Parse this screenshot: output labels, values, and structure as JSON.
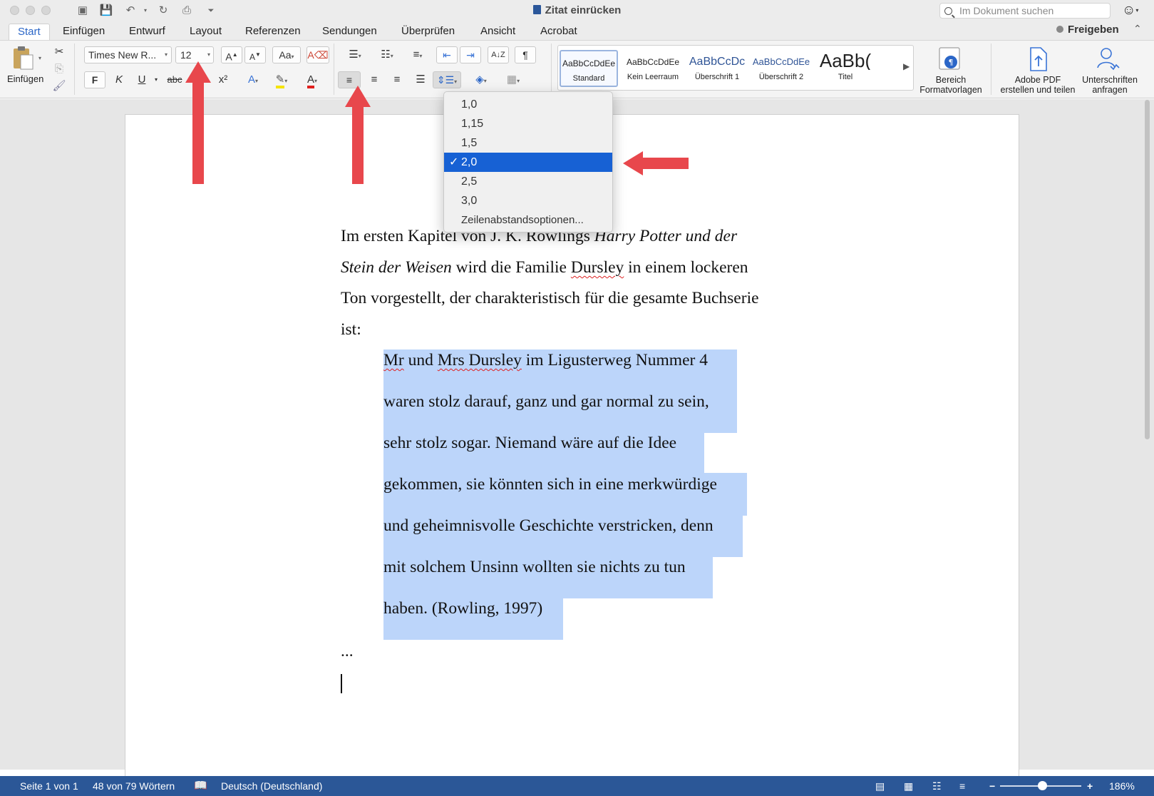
{
  "window": {
    "title": "Zitat einrücken",
    "search_placeholder": "Im Dokument suchen"
  },
  "tabs": [
    {
      "label": "Start",
      "active": true
    },
    {
      "label": "Einfügen"
    },
    {
      "label": "Entwurf"
    },
    {
      "label": "Layout"
    },
    {
      "label": "Referenzen"
    },
    {
      "label": "Sendungen"
    },
    {
      "label": "Überprüfen"
    },
    {
      "label": "Ansicht"
    },
    {
      "label": "Acrobat"
    }
  ],
  "share_label": "Freigeben",
  "ribbon": {
    "paste_label": "Einfügen",
    "font_name": "Times New R...",
    "font_size": "12",
    "bold": "F",
    "italic": "K",
    "underline": "U",
    "strike": "abc",
    "superscript": "x²",
    "styles": [
      {
        "sample": "AaBbCcDdEe",
        "name": "Standard",
        "selected": true
      },
      {
        "sample": "AaBbCcDdEe",
        "name": "Kein Leerraum"
      },
      {
        "sample": "AaBbCcDc",
        "name": "Überschrift 1"
      },
      {
        "sample": "AaBbCcDdEe",
        "name": "Überschrift 2"
      },
      {
        "sample": "AaBb(",
        "name": "Titel"
      }
    ],
    "styles_pane": "Bereich\nFormatvorlagen",
    "adobe_pdf": "Adobe PDF\nerstellen und teilen",
    "signatures": "Unterschriften\nanfragen"
  },
  "line_spacing_menu": {
    "items": [
      "1,0",
      "1,15",
      "1,5",
      "2,0",
      "2,5",
      "3,0",
      "Zeilenabstandsoptionen..."
    ],
    "selected_index": 3,
    "check": "✓"
  },
  "document": {
    "paragraph": {
      "line1_a": "Im ersten Kapitel von J. K. Rowlings ",
      "line1_b": "Harry Potter und der",
      "line2_a": "Stein der Weisen",
      "line2_b": " wird die Familie ",
      "line2_c": "Dursley",
      "line2_d": " in einem lockeren",
      "line3": "Ton vorgestellt, der charakteristisch für die gesamte Buchserie",
      "line4": "ist:"
    },
    "quote": {
      "l1_a": "Mr",
      "l1_b": " und ",
      "l1_c": "Mrs Dursley",
      "l1_d": " im Ligusterweg Nummer 4",
      "l2": "waren stolz darauf, ganz und gar normal zu sein,",
      "l3": "sehr stolz sogar. Niemand wäre auf die Idee",
      "l4": "gekommen, sie könnten sich in eine merkwürdige",
      "l5": "und geheimnisvolle Geschichte verstricken, denn",
      "l6": "mit solchem Unsinn wollten sie nichts zu tun",
      "l7": "haben. (Rowling, 1997)"
    },
    "ellipsis": "..."
  },
  "status": {
    "page": "Seite 1 von 1",
    "words": "48 von 79 Wörtern",
    "language": "Deutsch (Deutschland)",
    "zoom": "186%",
    "zoom_minus": "−",
    "zoom_plus": "+",
    "zoom_level": 0.52
  },
  "colors": {
    "accent": "#2b5797",
    "selection": "#bcd5fa",
    "menu_highlight": "#1761d4",
    "arrow": "#e8474c"
  }
}
